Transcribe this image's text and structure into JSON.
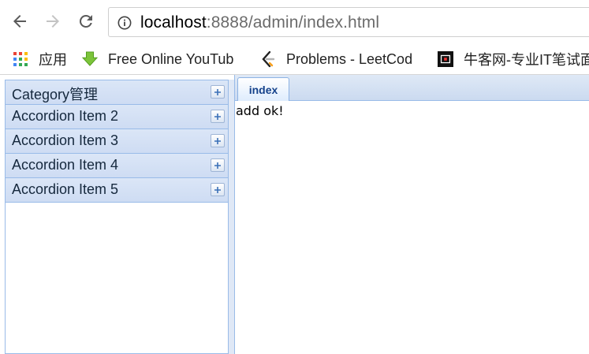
{
  "browser": {
    "url_host": "localhost",
    "url_rest": ":8888/admin/index.html"
  },
  "bookmarks": [
    {
      "label": "应用",
      "icon": "apps-grid-icon"
    },
    {
      "label": "Free Online YouTub",
      "icon": "download-arrow-icon"
    },
    {
      "label": "Problems - LeetCod",
      "icon": "leetcode-icon"
    },
    {
      "label": "牛客网-专业IT笔试面",
      "icon": "nowcoder-icon"
    }
  ],
  "accordion": {
    "items": [
      {
        "label": "Category管理"
      },
      {
        "label": "Accordion Item 2"
      },
      {
        "label": "Accordion Item 3"
      },
      {
        "label": "Accordion Item 4"
      },
      {
        "label": "Accordion Item 5"
      }
    ]
  },
  "tabs": [
    {
      "label": "index"
    }
  ],
  "content": {
    "message": "add ok!"
  },
  "colors": {
    "panel_border": "#99bbe8",
    "header_bg": "#dbe6f7",
    "tab_text": "#15428b"
  }
}
